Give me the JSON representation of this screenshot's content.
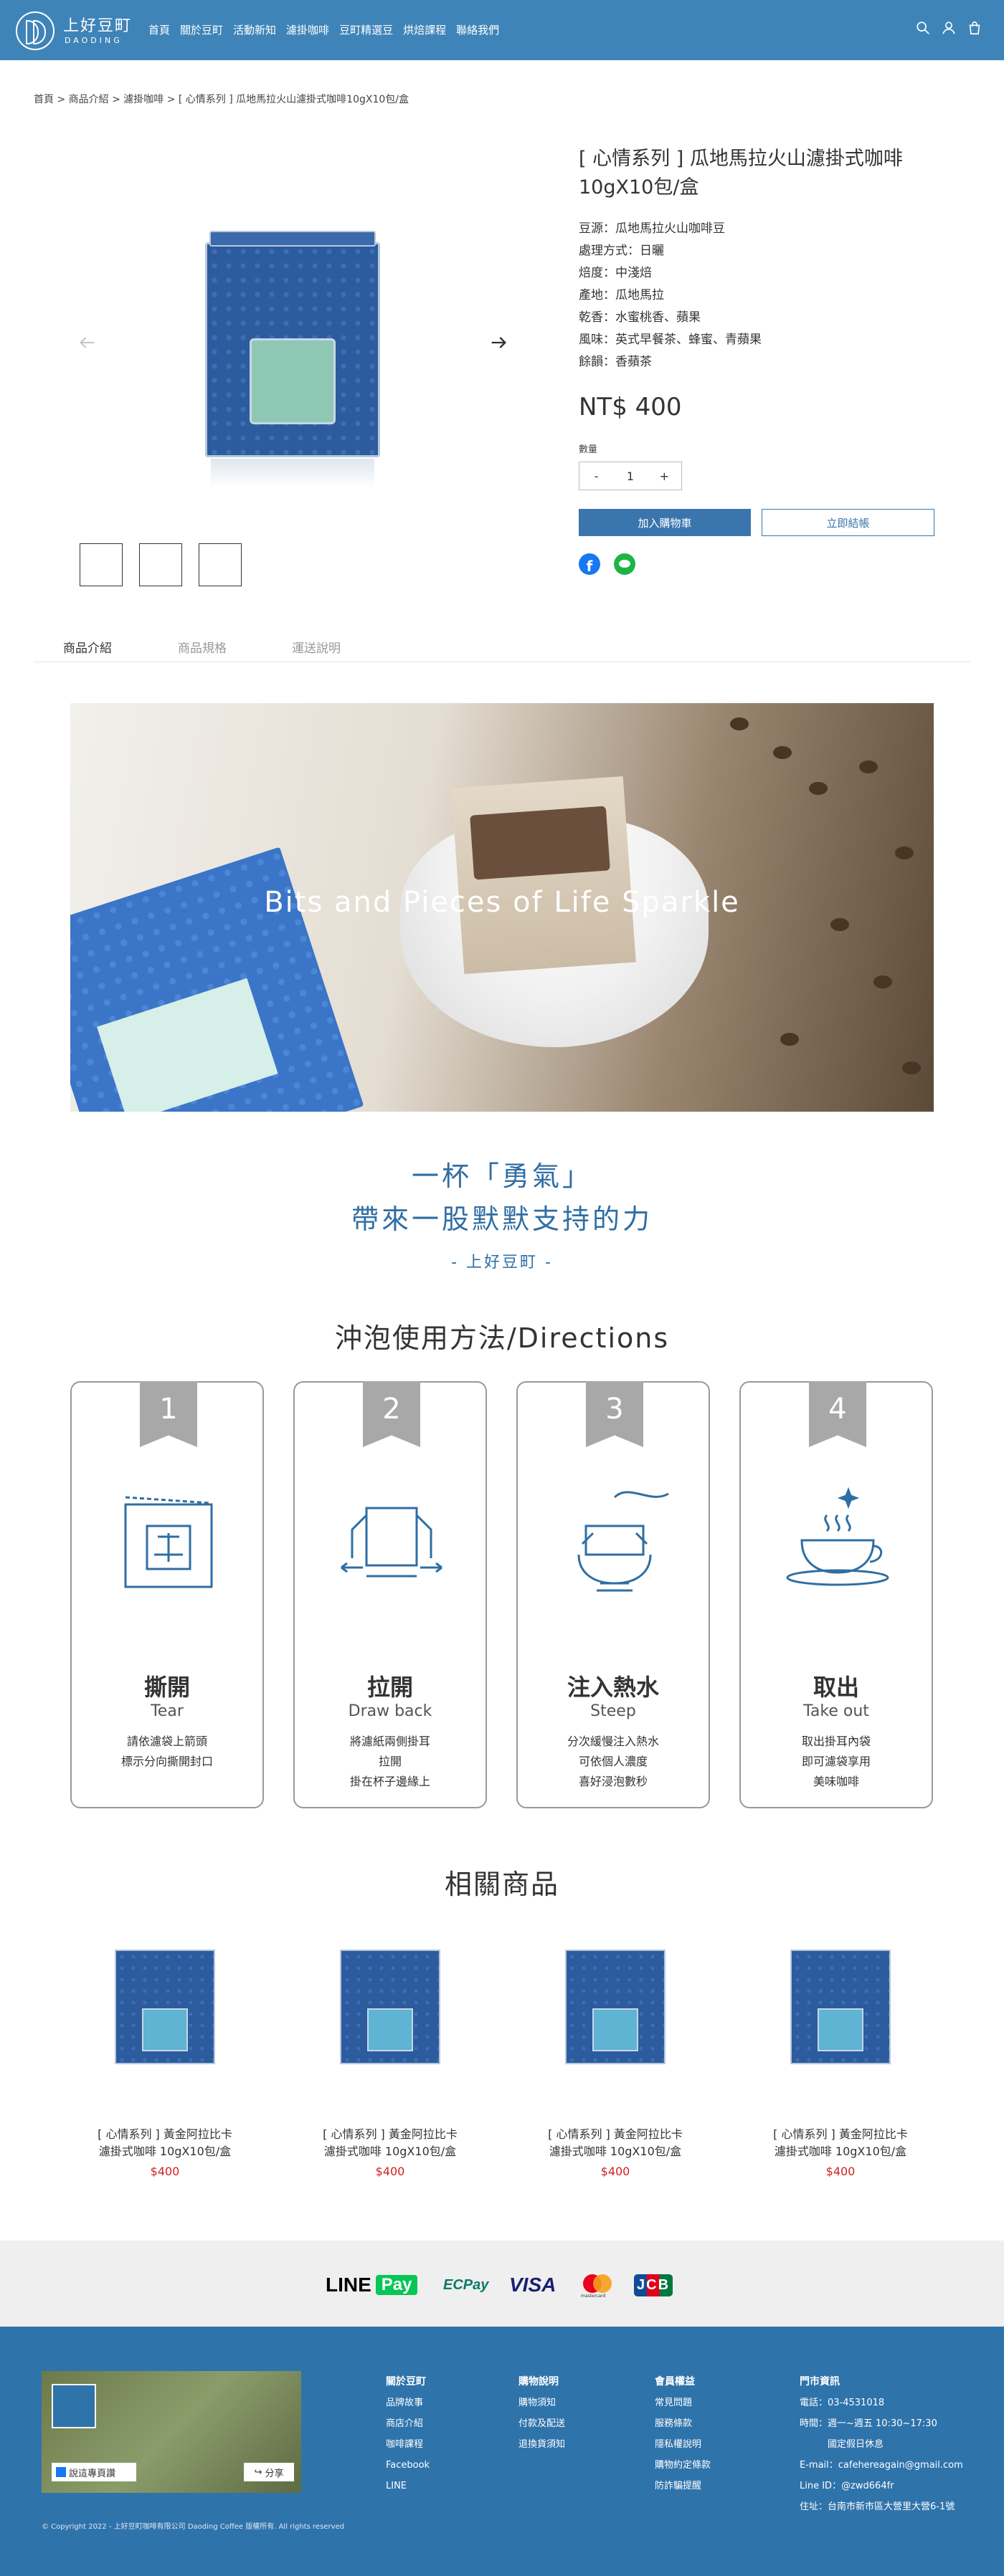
{
  "header": {
    "brand_cn": "上好豆町",
    "brand_en": "DAODING",
    "nav": [
      "首頁",
      "關於豆町",
      "活動新知",
      "濾掛咖啡",
      "豆町精選豆",
      "烘焙課程",
      "聯絡我們"
    ]
  },
  "breadcrumb": "首頁 > 商品介紹 > 濾掛咖啡 > [ 心情系列 ] 瓜地馬拉火山濾掛式咖啡10gX10包/盒",
  "product": {
    "title": "[ 心情系列 ] 瓜地馬拉火山濾掛式咖啡10gX10包/盒",
    "specs": [
      "豆源：瓜地馬拉火山咖啡豆",
      "處理方式：日曬",
      "焙度：中淺焙",
      "產地：瓜地馬拉",
      "乾香：水蜜桃香、蘋果",
      "風味：英式早餐茶、蜂蜜、青蘋果",
      "餘韻：香蘋茶"
    ],
    "price": "NT$ 400",
    "qty_label": "數量",
    "qty_minus": "-",
    "qty_value": "1",
    "qty_plus": "+",
    "add_to_cart": "加入購物車",
    "buy_now": "立即結帳"
  },
  "tabs": [
    "商品介紹",
    "商品規格",
    "運送說明"
  ],
  "banner_text": "Bits and Pieces of Life Sparkle",
  "slogan": {
    "line1": "一杯「勇氣」",
    "line2": "帶來一股默默支持的力",
    "line3": "- 上好豆町 -"
  },
  "directions": {
    "title": "沖泡使用方法/Directions",
    "steps": [
      {
        "num": "1",
        "cn": "撕開",
        "en": "Tear",
        "desc": [
          "請依濾袋上箭頭",
          "標示分向撕開封口"
        ]
      },
      {
        "num": "2",
        "cn": "拉開",
        "en": "Draw back",
        "desc": [
          "將濾紙兩側掛耳",
          "拉開",
          "掛在杯子邊緣上"
        ]
      },
      {
        "num": "3",
        "cn": "注入熱水",
        "en": "Steep",
        "desc": [
          "分次緩慢注入熱水",
          "可依個人濃度",
          "喜好浸泡數秒"
        ]
      },
      {
        "num": "4",
        "cn": "取出",
        "en": "Take out",
        "desc": [
          "取出掛耳內袋",
          "即可濾袋享用",
          "美味咖啡"
        ]
      }
    ]
  },
  "related": {
    "title": "相關商品",
    "items": [
      {
        "name1": "[ 心情系列 ] 黃金阿拉比卡",
        "name2": "濾掛式咖啡 10gX10包/盒",
        "price": "$400"
      },
      {
        "name1": "[ 心情系列 ] 黃金阿拉比卡",
        "name2": "濾掛式咖啡 10gX10包/盒",
        "price": "$400"
      },
      {
        "name1": "[ 心情系列 ] 黃金阿拉比卡",
        "name2": "濾掛式咖啡 10gX10包/盒",
        "price": "$400"
      },
      {
        "name1": "[ 心情系列 ] 黃金阿拉比卡",
        "name2": "濾掛式咖啡 10gX10包/盒",
        "price": "$400"
      }
    ]
  },
  "payments": {
    "line": "LINE",
    "pay": "Pay",
    "ecpay": "ECPay",
    "visa": "VISA",
    "mastercard": "mastercard",
    "jcb": "JCB"
  },
  "footer": {
    "fb_like": "說這專頁讚",
    "fb_share": "分享",
    "col1": {
      "title": "關於豆町",
      "items": [
        "品牌故事",
        "商店介紹",
        "咖啡課程",
        "Facebook",
        "LINE"
      ]
    },
    "col2": {
      "title": "購物說明",
      "items": [
        "購物須知",
        "付款及配送",
        "退換貨須知"
      ]
    },
    "col3": {
      "title": "會員權益",
      "items": [
        "常見問題",
        "服務條款",
        "隱私權說明",
        "購物約定條款",
        "防詐騙提醒"
      ]
    },
    "col4": {
      "title": "門市資訊",
      "items": [
        "電話：03-4531018",
        "時間：週一~週五 10:30~17:30",
        "　　　國定假日休息",
        "E-mail：cafehereagain@gmail.com",
        "Line ID：@zwd664fr",
        "住址：台南市新市區大營里大營6-1號"
      ]
    },
    "copyright": "© Copyright 2022 - 上好豆町咖啡有限公司 Daoding Coffee 版權所有. All rights reserved"
  },
  "colors": {
    "primary": "#3f84b8",
    "accent_blue": "#2f6ea3",
    "footer": "#2f73ab",
    "price_red": "#d21f1f"
  }
}
